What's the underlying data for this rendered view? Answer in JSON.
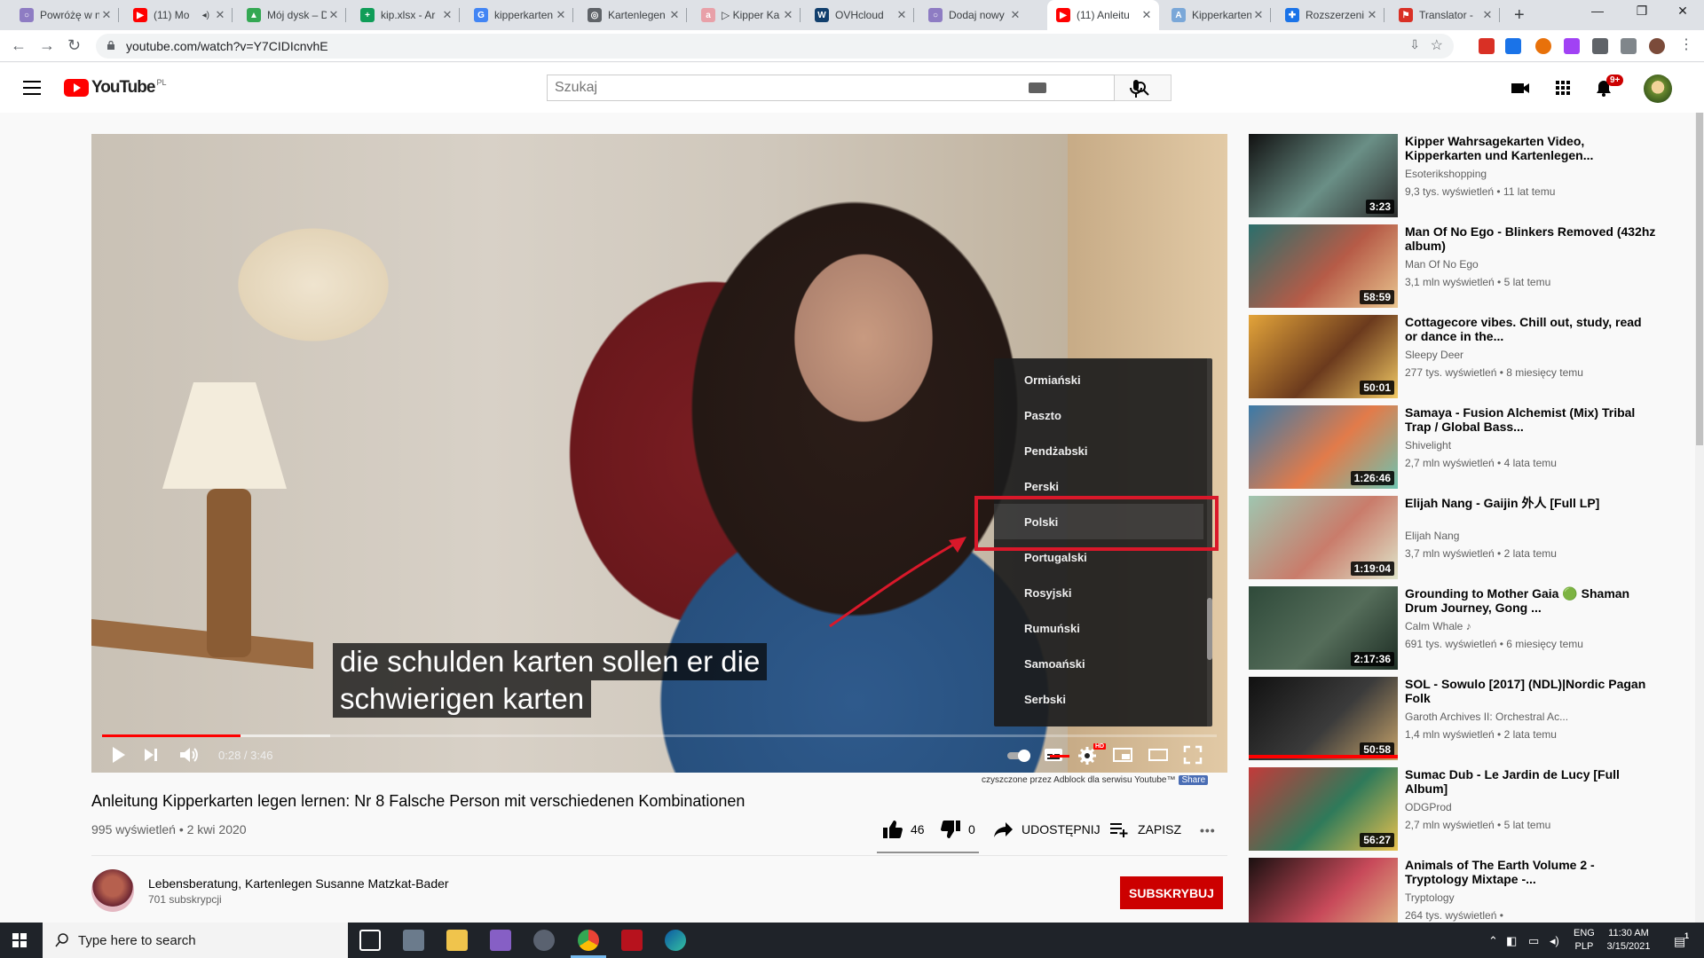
{
  "browser": {
    "tabs": [
      {
        "title": "Powróżę w n",
        "fav": "#8e7cc3",
        "glyph": "○"
      },
      {
        "title": "(11) Mo",
        "fav": "#ff0000",
        "glyph": "▶",
        "audio": "◂)"
      },
      {
        "title": "Mój dysk – D",
        "fav": "#34a853",
        "glyph": "▲"
      },
      {
        "title": "kip.xlsx - Ar",
        "fav": "#0f9d58",
        "glyph": "+"
      },
      {
        "title": "kipperkarten",
        "fav": "#4285f4",
        "glyph": "G"
      },
      {
        "title": "Kartenlegen",
        "fav": "#5f6368",
        "glyph": "◎"
      },
      {
        "title": "▷ Kipper Ka",
        "fav": "#e8a0a8",
        "glyph": "a"
      },
      {
        "title": "OVHcloud",
        "fav": "#123f6d",
        "glyph": "W"
      },
      {
        "title": "Dodaj nowy",
        "fav": "#8e7cc3",
        "glyph": "○"
      },
      {
        "title": "(11) Anleitu",
        "fav": "#ff0000",
        "glyph": "▶"
      },
      {
        "title": "Kipperkarten",
        "fav": "#7aa7d8",
        "glyph": "A"
      },
      {
        "title": "Rozszerzeni",
        "fav": "#1a73e8",
        "glyph": "✚"
      },
      {
        "title": "Translator -",
        "fav": "#d93025",
        "glyph": "⚑"
      }
    ],
    "new_tab": "+",
    "url": "youtube.com/watch?v=Y7CIDIcnvhE"
  },
  "youtube": {
    "logo_text": "YouTube",
    "country": "PL",
    "search_placeholder": "Szukaj",
    "notifications": "9+"
  },
  "player": {
    "subtitle_lines": [
      "die schulden karten sollen er die",
      "schwierigen karten"
    ],
    "languages": [
      "Ormiański",
      "Paszto",
      "Pendżabski",
      "Perski",
      "Polski",
      "Portugalski",
      "Rosyjski",
      "Rumuński",
      "Samoański",
      "Serbski"
    ],
    "selected_language": "Polski",
    "time_current": "0:28",
    "time_total": "3:46",
    "time_display": "0:28 / 3:46",
    "played_fraction": 0.124,
    "buffered_fraction": 0.205,
    "hd_badge": "HD"
  },
  "adblock": {
    "note": "czyszczone przez Adblock dla serwisu Youtube™",
    "share": "Share"
  },
  "video": {
    "title": "Anleitung Kipperkarten legen lernen: Nr 8 Falsche Person mit verschiedenen Kombinationen",
    "meta": "995 wyświetleń • 2 kwi 2020",
    "likes": "46",
    "dislikes": "0",
    "share_label": "UDOSTĘPNIJ",
    "save_label": "ZAPISZ",
    "more": "•••"
  },
  "channel": {
    "name": "Lebensberatung, Kartenlegen Susanne Matzkat-Bader",
    "subs": "701 subskrypcji",
    "subscribe_label": "SUBSKRYBUJ"
  },
  "recommendations": [
    {
      "title": "Kipper Wahrsagekarten Video, Kipperkarten und Kartenlegen...",
      "channel": "Esoterikshopping",
      "meta": "9,3 tys. wyświetleń • 11 lat temu",
      "duration": "3:23",
      "colors": [
        "#111111",
        "#6a8f86",
        "#2b2b2b"
      ]
    },
    {
      "title": "Man Of No Ego - Blinkers Removed (432hz album)",
      "channel": "Man Of No Ego",
      "meta": "3,1 mln wyświetleń • 5 lat temu",
      "duration": "58:59",
      "colors": [
        "#2a6f6c",
        "#b65b47",
        "#e9c58f"
      ]
    },
    {
      "title": "Cottagecore vibes. Chill out, study, read or dance in the...",
      "channel": "Sleepy Deer",
      "meta": "277 tys. wyświetleń • 8 miesięcy temu",
      "duration": "50:01",
      "colors": [
        "#e3a43a",
        "#6b3a1d",
        "#f1c964"
      ]
    },
    {
      "title": "Samaya - Fusion Alchemist (Mix) Tribal Trap / Global Bass...",
      "channel": "Shivelight",
      "meta": "2,7 mln wyświetleń • 4 lata temu",
      "duration": "1:26:46",
      "colors": [
        "#3a7aa8",
        "#e27b4a",
        "#6ec3b0"
      ]
    },
    {
      "title": "Elijah Nang - Gaijin 外人 [Full LP]",
      "channel": "Elijah Nang",
      "meta": "3,7 mln wyświetleń • 2 lata temu",
      "duration": "1:19:04",
      "colors": [
        "#9fc6b0",
        "#c97c6b",
        "#dfe4c9"
      ]
    },
    {
      "title": "Grounding to Mother Gaia 🟢 Shaman Drum Journey, Gong ...",
      "channel": "Calm Whale ♪",
      "meta": "691 tys. wyświetleń • 6 miesięcy temu",
      "duration": "2:17:36",
      "colors": [
        "#2f4a3a",
        "#556d5a",
        "#1d2d24"
      ]
    },
    {
      "title": "SOL - Sowulo [2017] (NDL)|Nordic Pagan Folk",
      "channel": "Garoth Archives II: Orchestral Ac...",
      "meta": "1,4 mln wyświetleń • 2 lata temu",
      "duration": "50:58",
      "colors": [
        "#111111",
        "#3b3b3b",
        "#c7a36a"
      ]
    },
    {
      "title": "Sumac Dub - Le Jardin de Lucy [Full Album]",
      "channel": "ODGProd",
      "meta": "2,7 mln wyświetleń • 5 lat temu",
      "duration": "56:27",
      "colors": [
        "#c33a3a",
        "#2f7a5a",
        "#e8c14e"
      ]
    },
    {
      "title": "Animals of The Earth Volume 2 - Tryptology Mixtape -...",
      "channel": "Tryptology",
      "meta": "264 tys. wyświetleń •",
      "duration": "",
      "colors": [
        "#1a1010",
        "#c84a5a",
        "#e2c38a"
      ]
    }
  ],
  "taskbar": {
    "search_placeholder": "Type here to search",
    "lang_top": "ENG",
    "lang_bottom": "PLP",
    "time": "11:30 AM",
    "date": "3/15/2021",
    "notif_count": "1"
  },
  "colors": {
    "youtube_red": "#ff0000",
    "subscribe_red": "#cc0000",
    "annotation_red": "#d9182a"
  }
}
